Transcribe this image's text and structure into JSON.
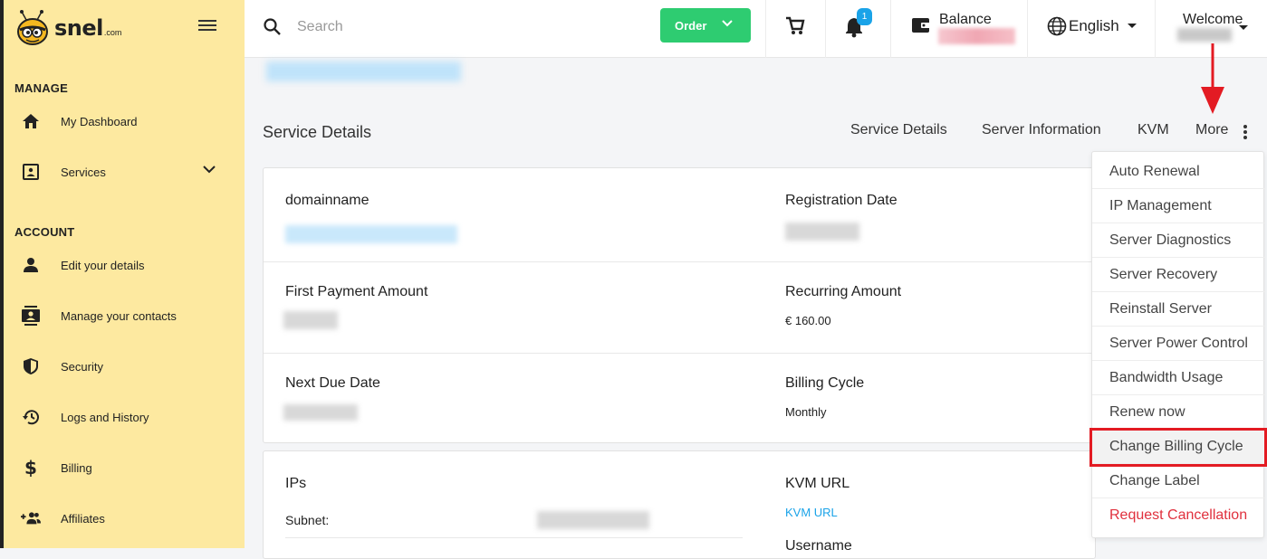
{
  "brand": {
    "name": "snel",
    "domain": ".com"
  },
  "sidebar": {
    "manage_title": "MANAGE",
    "account_title": "ACCOUNT",
    "items": [
      {
        "label": "My Dashboard",
        "icon": "home-icon"
      },
      {
        "label": "Services",
        "icon": "services-icon"
      },
      {
        "label": "Edit your details",
        "icon": "person-icon"
      },
      {
        "label": "Manage your contacts",
        "icon": "contacts-icon"
      },
      {
        "label": "Security",
        "icon": "shield-icon"
      },
      {
        "label": "Logs and History",
        "icon": "history-icon"
      },
      {
        "label": "Billing",
        "icon": "dollar-icon"
      },
      {
        "label": "Affiliates",
        "icon": "group-add-icon"
      }
    ]
  },
  "topbar": {
    "search_placeholder": "Search",
    "order_label": "Order",
    "notifications_count": "1",
    "balance_label": "Balance",
    "language_label": "English",
    "welcome_label": "Welcome"
  },
  "page": {
    "title": "Service Details",
    "tabs": [
      "Service Details",
      "Server Information",
      "KVM",
      "More"
    ]
  },
  "details": {
    "domainname_label": "domainname",
    "registration_label": "Registration Date",
    "first_payment_label": "First Payment Amount",
    "recurring_label": "Recurring Amount",
    "recurring_value": "€ 160.00",
    "next_due_label": "Next Due Date",
    "billing_cycle_label": "Billing Cycle",
    "billing_cycle_value": "Monthly"
  },
  "network": {
    "ips_label": "IPs",
    "subnet_label": "Subnet:",
    "kvm_url_label": "KVM URL",
    "kvm_url_link": "KVM URL",
    "username_label": "Username"
  },
  "more_menu": {
    "items": [
      "Auto Renewal",
      "IP Management",
      "Server Diagnostics",
      "Server Recovery",
      "Reinstall Server",
      "Server Power Control",
      "Bandwidth Usage",
      "Renew now",
      "Change Billing Cycle",
      "Change Label",
      "Request Cancellation"
    ],
    "highlighted": "Change Billing Cycle",
    "danger_color": "#e0303d"
  },
  "colors": {
    "sidebar_bg": "#fde9a0",
    "order_green": "#2ecc71",
    "link_blue": "#1aa3e8",
    "highlight_red": "#e31b23"
  }
}
